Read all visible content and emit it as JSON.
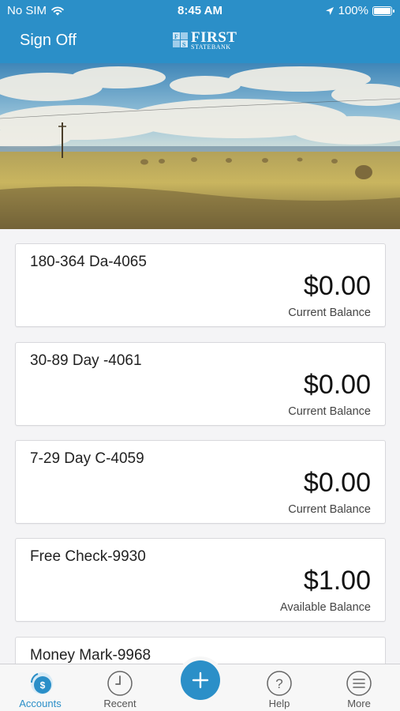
{
  "status_bar": {
    "carrier": "No SIM",
    "time": "8:45 AM",
    "battery": "100%",
    "icons": [
      "wifi-icon",
      "location-arrow-icon",
      "battery-icon"
    ]
  },
  "nav": {
    "sign_off_label": "Sign Off",
    "logo_line1": "FIRST",
    "logo_line2": "STATEBANK"
  },
  "accounts": [
    {
      "name": "180-364 Da-4065",
      "amount": "$0.00",
      "balance_label": "Current Balance"
    },
    {
      "name": "30-89 Day -4061",
      "amount": "$0.00",
      "balance_label": "Current Balance"
    },
    {
      "name": "7-29 Day C-4059",
      "amount": "$0.00",
      "balance_label": "Current Balance"
    },
    {
      "name": "Free Check-9930",
      "amount": "$1.00",
      "balance_label": "Available Balance"
    },
    {
      "name": "Money Mark-9968",
      "amount": "",
      "balance_label": ""
    }
  ],
  "tab_bar": {
    "items": [
      {
        "label": "Accounts",
        "icon": "accounts-dollar-icon",
        "active": true
      },
      {
        "label": "Recent",
        "icon": "clock-icon",
        "active": false
      },
      {
        "label": "",
        "icon": "plus-icon",
        "active": false
      },
      {
        "label": "Help",
        "icon": "question-icon",
        "active": false
      },
      {
        "label": "More",
        "icon": "menu-icon",
        "active": false
      }
    ]
  },
  "colors": {
    "brand": "#2b8fc8",
    "background": "#f4f4f6",
    "card": "#ffffff"
  }
}
